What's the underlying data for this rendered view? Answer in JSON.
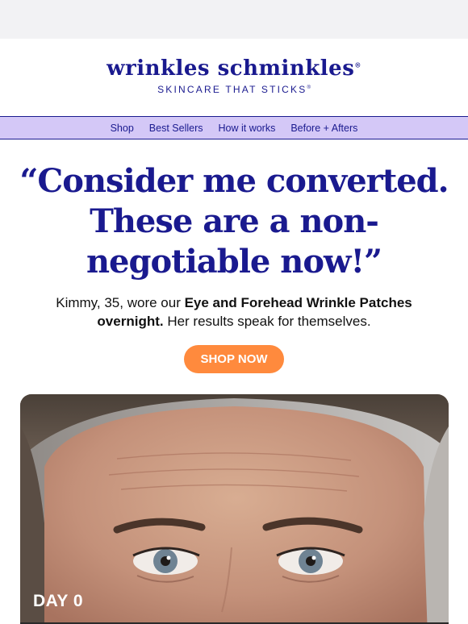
{
  "brand": {
    "name": "wrinkles schminkles",
    "name_mark": "®",
    "tagline": "SKINCARE THAT STICKS",
    "tagline_mark": "®",
    "color": "#1a1a8f"
  },
  "nav": {
    "items": [
      {
        "label": "Shop"
      },
      {
        "label": "Best Sellers"
      },
      {
        "label": "How it works"
      },
      {
        "label": "Before + Afters"
      }
    ],
    "background": "#d4c8f7"
  },
  "hero": {
    "headline_line1": "“Consider me converted.",
    "headline_line2": "These are a non-",
    "headline_line3": "negotiable now!”",
    "sub_prefix": "Kimmy, 35, wore our ",
    "sub_bold": "Eye and Forehead Wrinkle Patches overnight.",
    "sub_suffix": " Her results speak for themselves.",
    "cta_label": "SHOP NOW",
    "cta_color": "#ff8a3d"
  },
  "photo": {
    "day_label": "DAY 0"
  }
}
